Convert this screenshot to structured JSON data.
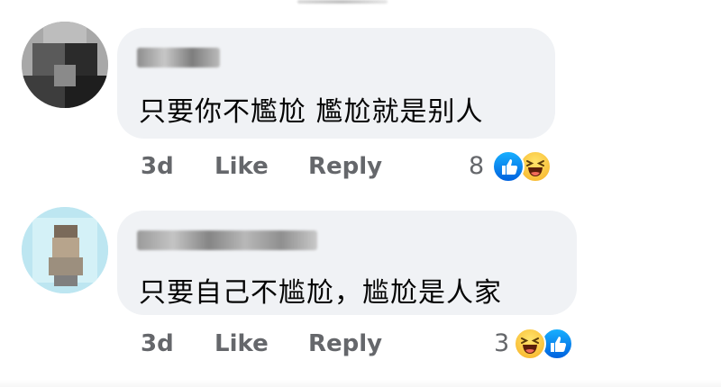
{
  "comments": [
    {
      "text": "只要你不尷尬 尷尬就是别人",
      "time": "3d",
      "like_label": "Like",
      "reply_label": "Reply",
      "reaction_count": "8",
      "reactions": [
        "like-icon",
        "haha-icon"
      ]
    },
    {
      "text": "只要自己不尴尬，尴尬是人家",
      "time": "3d",
      "like_label": "Like",
      "reply_label": "Reply",
      "reaction_count": "3",
      "reactions": [
        "haha-icon",
        "like-icon"
      ]
    }
  ],
  "colors": {
    "bubble": "#f0f2f5",
    "action_text": "#65676b",
    "body_text": "#050505",
    "like_blue": "#1877f2",
    "haha_yellow": "#f7b125"
  }
}
